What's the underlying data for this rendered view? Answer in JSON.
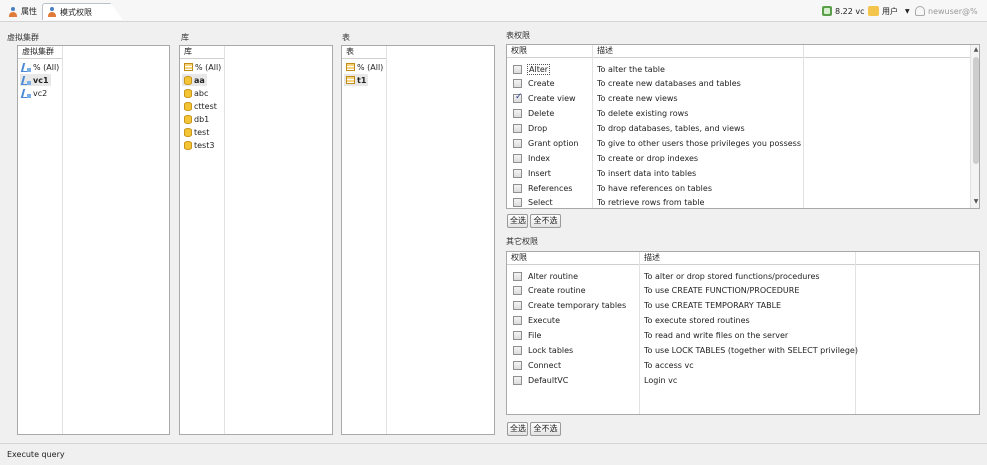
{
  "tabs": [
    {
      "label": "属性",
      "icon": "user-icon",
      "active": false
    },
    {
      "label": "模式权限",
      "icon": "user-icon",
      "active": true
    }
  ],
  "topbar": {
    "db_label": "8.22 vc",
    "user_menu_label": "用户",
    "user_name": "newuser@%"
  },
  "clusters": {
    "section_title": "虚拟集群",
    "column_header": "虚拟集群",
    "items": [
      {
        "label": "% (All)",
        "bold": false
      },
      {
        "label": "vc1",
        "bold": true
      },
      {
        "label": "vc2",
        "bold": false
      }
    ]
  },
  "databases": {
    "section_title": "库",
    "column_header": "库",
    "items": [
      {
        "label": "% (All)",
        "icon": "table-icon",
        "bold": false
      },
      {
        "label": "aa",
        "icon": "database-icon",
        "bold": true
      },
      {
        "label": "abc",
        "icon": "database-icon",
        "bold": false
      },
      {
        "label": "cttest",
        "icon": "database-icon",
        "bold": false
      },
      {
        "label": "db1",
        "icon": "database-icon",
        "bold": false
      },
      {
        "label": "test",
        "icon": "database-icon",
        "bold": false
      },
      {
        "label": "test3",
        "icon": "database-icon",
        "bold": false
      }
    ]
  },
  "tables": {
    "section_title": "表",
    "column_header": "表",
    "items": [
      {
        "label": "% (All)",
        "bold": false
      },
      {
        "label": "t1",
        "bold": true
      }
    ]
  },
  "table_privileges": {
    "section_title": "表权限",
    "col_privilege": "权限",
    "col_description": "描述",
    "rows": [
      {
        "name": "Alter",
        "description": "To alter the table",
        "checked": false
      },
      {
        "name": "Create",
        "description": "To create new databases and tables",
        "checked": false
      },
      {
        "name": "Create view",
        "description": "To create new views",
        "checked": true
      },
      {
        "name": "Delete",
        "description": "To delete existing rows",
        "checked": false
      },
      {
        "name": "Drop",
        "description": "To drop databases, tables, and views",
        "checked": false
      },
      {
        "name": "Grant option",
        "description": "To give to other users those privileges you possess",
        "checked": false
      },
      {
        "name": "Index",
        "description": "To create or drop indexes",
        "checked": false
      },
      {
        "name": "Insert",
        "description": "To insert data into tables",
        "checked": false
      },
      {
        "name": "References",
        "description": "To have references on tables",
        "checked": false
      },
      {
        "name": "Select",
        "description": "To retrieve rows from table",
        "checked": false
      }
    ],
    "select_all": "全选",
    "deselect_all": "全不选"
  },
  "other_privileges": {
    "section_title": "其它权限",
    "col_privilege": "权限",
    "col_description": "描述",
    "rows": [
      {
        "name": "Alter routine",
        "description": "To alter or drop stored functions/procedures",
        "checked": false
      },
      {
        "name": "Create routine",
        "description": "To use CREATE FUNCTION/PROCEDURE",
        "checked": false
      },
      {
        "name": "Create temporary tables",
        "description": "To use CREATE TEMPORARY TABLE",
        "checked": false
      },
      {
        "name": "Execute",
        "description": "To execute stored routines",
        "checked": false
      },
      {
        "name": "File",
        "description": "To read and write files on the server",
        "checked": false
      },
      {
        "name": "Lock tables",
        "description": "To use LOCK TABLES (together with SELECT privilege)",
        "checked": false
      },
      {
        "name": "Connect",
        "description": "To access vc",
        "checked": false
      },
      {
        "name": "DefaultVC",
        "description": "Login vc",
        "checked": false
      }
    ],
    "select_all": "全选",
    "deselect_all": "全不选"
  },
  "status": {
    "text": "Execute query"
  }
}
